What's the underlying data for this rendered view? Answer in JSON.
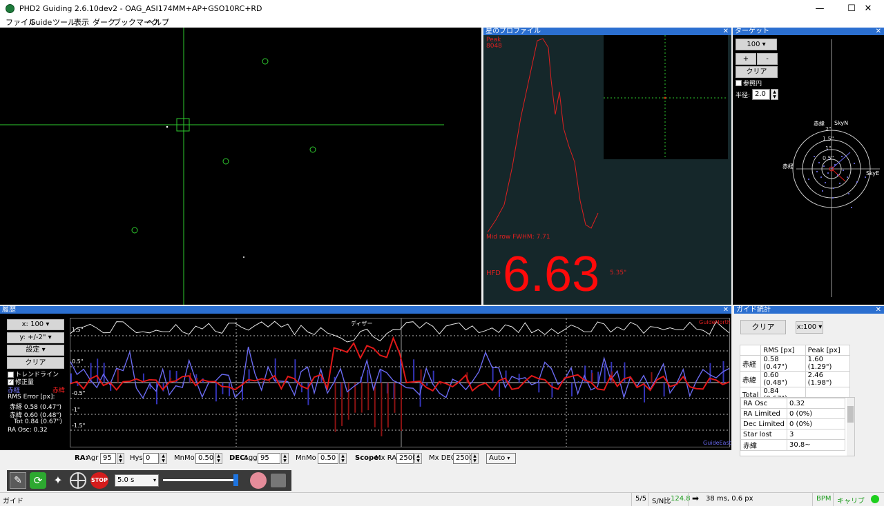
{
  "window": {
    "title": "PHD2 Guiding 2.6.10dev2 - OAG_ASI174MM+AP+GSO10RC+RD",
    "minimize": "—",
    "maximize": "☐",
    "close": "✕"
  },
  "menu": [
    "ファイル",
    "Guide",
    "ツール",
    "表示",
    "ダーク",
    "ブックマーク",
    "ヘルプ"
  ],
  "star_profile": {
    "title": "星のプロファイル",
    "peak_label": "Peak",
    "peak_value": "8048",
    "fwhm_label": "Mid row FWHM: 7.71",
    "hfd_label": "HFD",
    "hfd_value": "6.63",
    "hfd_arcsec": "5.35\""
  },
  "target": {
    "title": "ターゲット",
    "zoom": "100",
    "plus": "+",
    "minus": "-",
    "clear": "クリア",
    "reference_circle": "参照円",
    "radius_label": "半径:",
    "radius_value": "2.0",
    "dec_label": "赤緯",
    "ra_label": "赤経",
    "skyn": "SkyN",
    "skye": "SkyE",
    "rings": [
      "2\"",
      "1.5\"",
      "1\"",
      "0.5\""
    ]
  },
  "history": {
    "title": "履歴",
    "x_scale": "x: 100",
    "y_scale": "y: +/-2\"",
    "settings": "設定",
    "clear": "クリア",
    "trendline": "トレンドライン",
    "correction": "修正量",
    "ra_legend": "赤経",
    "dec_legend": "赤緯",
    "rms_error": "RMS Error [px]:",
    "ra_rms": "赤経 0.58 (0.47\")",
    "dec_rms": "赤緯 0.60 (0.48\")",
    "tot_rms": "Tot 0.84 (0.67\")",
    "ra_osc": "RA Osc: 0.32",
    "guide_north": "GuideNorth",
    "guide_east": "GuideEast",
    "dither": "ディザー",
    "y_ticks": [
      "1.5\"",
      "0.5\"",
      "-0.5\"",
      "-1\"",
      "-1.5\""
    ],
    "ra_ctrl": {
      "ra_label": "RA:",
      "agr_label": "Agr",
      "agr": "95",
      "hys_label": "Hys",
      "hys": "0",
      "mnmo_label": "MnMo",
      "mnmo": "0.50"
    },
    "dec_ctrl": {
      "dec_label": "DEC:",
      "agg_label": "Agg",
      "agg": "95",
      "mnmo_label": "MnMo",
      "mnmo": "0.50"
    },
    "scope": {
      "scope_label": "Scope:",
      "mxra_label": "Mx RA",
      "mxra": "2500",
      "mxdec_label": "Mx DEC",
      "mxdec": "2500",
      "mode": "Auto"
    }
  },
  "guide_stats": {
    "title": "ガイド統計",
    "clear": "クリア",
    "scale": "x:100",
    "headers": [
      "",
      "RMS [px]",
      "Peak [px]"
    ],
    "rows": [
      [
        "赤経",
        "0.58 (0.47\")",
        "1.60 (1.29\")"
      ],
      [
        "赤緯",
        "0.60 (0.48\")",
        "2.46 (1.98\")"
      ],
      [
        "Total",
        "0.84 (0.67\")",
        ""
      ]
    ],
    "info_rows": [
      [
        "RA Osc",
        "0.32"
      ],
      [
        "RA Limited",
        "0 (0%)"
      ],
      [
        "Dec Limited",
        "0 (0%)"
      ],
      [
        "Star lost",
        "3"
      ],
      [
        "赤緯",
        "30.8~"
      ]
    ]
  },
  "toolbar": {
    "exposure": "5.0 s",
    "stop": "STOP"
  },
  "status": {
    "left": "ガイド",
    "frames": "5/5",
    "snr_label": "S/N比",
    "snr_value": "124.8",
    "pulse": "38 ms, 0.6 px",
    "bpm": "BPM",
    "calib": "キャリブ"
  },
  "colors": {
    "ra": "#6a6af0",
    "dec": "#e01818",
    "accent": "#2b6fd0",
    "green": "#1ecf1e"
  }
}
